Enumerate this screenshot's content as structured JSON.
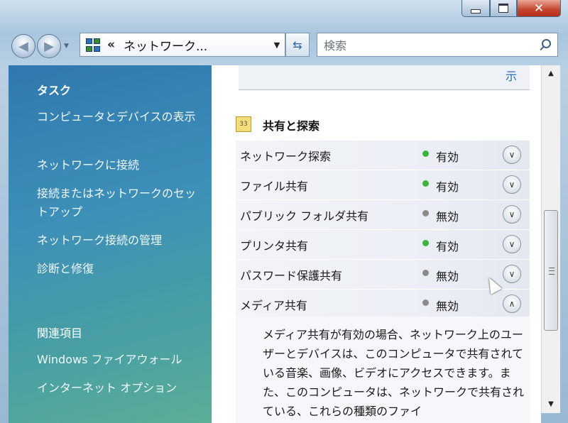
{
  "window": {
    "minimize_label": "",
    "maximize_label": "",
    "close_label": "✕"
  },
  "address_bar": {
    "chevron": "«",
    "path": "ネットワーク...",
    "dropdown": "▼",
    "refresh_icon": "refresh-icon"
  },
  "search": {
    "placeholder": "検索"
  },
  "sidebar": {
    "tasks_heading": "タスク",
    "tasks": [
      "コンピュータとデバイスの表示",
      "ネットワークに接続",
      "接続またはネットワークのセットアップ",
      "ネットワーク接続の管理",
      "診断と修復"
    ],
    "related_heading": "関連項目",
    "related": [
      "Windows ファイアウォール",
      "インターネット オプション"
    ]
  },
  "content": {
    "top_link": "示",
    "section_title": "共有と探索",
    "settings": [
      {
        "label": "ネットワーク探索",
        "status": "有効",
        "enabled": true,
        "expanded": false
      },
      {
        "label": "ファイル共有",
        "status": "有効",
        "enabled": true,
        "expanded": false
      },
      {
        "label": "パブリック フォルダ共有",
        "status": "無効",
        "enabled": false,
        "expanded": false
      },
      {
        "label": "プリンタ共有",
        "status": "有効",
        "enabled": true,
        "expanded": false
      },
      {
        "label": "パスワード保護共有",
        "status": "無効",
        "enabled": false,
        "expanded": false
      },
      {
        "label": "メディア共有",
        "status": "無効",
        "enabled": false,
        "expanded": true
      }
    ],
    "description": "メディア共有が有効の場合、ネットワーク上のユーザーとデバイスは、このコンピュータで共有されている音楽、画像、ビデオにアクセスできます。また、このコンピュータは、ネットワークで共有されている、これらの種類のファイ"
  },
  "colors": {
    "enabled_dot": "#3cb33c",
    "disabled_dot": "#8a8a8a"
  }
}
